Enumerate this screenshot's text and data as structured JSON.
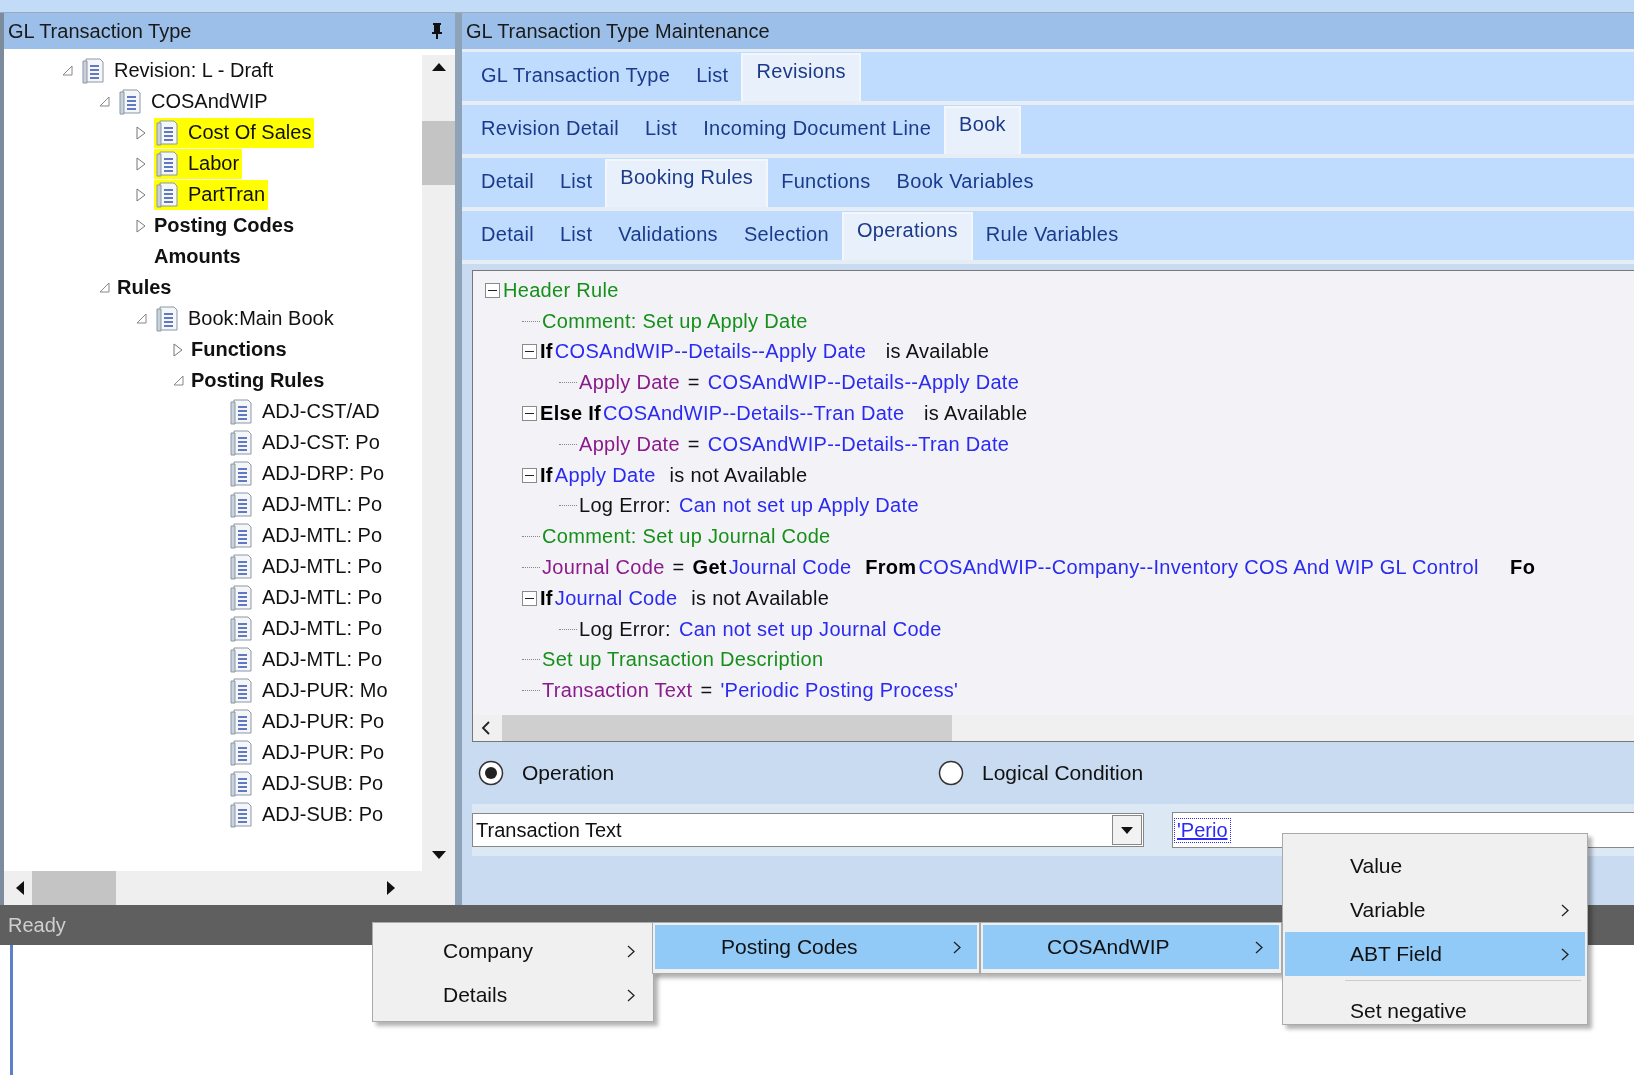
{
  "left_panel": {
    "title": "GL Transaction Type",
    "tree": [
      {
        "label": "Revision: L - Draft",
        "kind": "doc",
        "expanded": true,
        "highlighted": false,
        "children": [
          {
            "label": "COSAndWIP",
            "kind": "doc",
            "expanded": true,
            "highlighted": false,
            "children": [
              {
                "label": "Cost Of Sales",
                "kind": "doc",
                "expanded": false,
                "highlighted": true
              },
              {
                "label": "Labor",
                "kind": "doc",
                "expanded": false,
                "highlighted": true
              },
              {
                "label": "PartTran",
                "kind": "doc",
                "expanded": false,
                "highlighted": true
              },
              {
                "label": "Posting Codes",
                "kind": "group",
                "expanded": false,
                "highlighted": false
              },
              {
                "label": "Amounts",
                "kind": "group",
                "highlighted": false
              }
            ]
          },
          {
            "label": "Rules",
            "kind": "group",
            "expanded": true,
            "highlighted": false,
            "children": [
              {
                "label": "Book:Main Book",
                "kind": "doc",
                "expanded": true,
                "highlighted": false,
                "children": [
                  {
                    "label": "Functions",
                    "kind": "group",
                    "expanded": false,
                    "highlighted": false
                  },
                  {
                    "label": "Posting Rules",
                    "kind": "group",
                    "expanded": true,
                    "highlighted": false,
                    "children": [
                      {
                        "label": "ADJ-CST/AD",
                        "kind": "doc",
                        "highlighted": false
                      },
                      {
                        "label": "ADJ-CST: Po",
                        "kind": "doc",
                        "highlighted": false
                      },
                      {
                        "label": "ADJ-DRP: Po",
                        "kind": "doc",
                        "highlighted": false
                      },
                      {
                        "label": "ADJ-MTL: Po",
                        "kind": "doc",
                        "highlighted": false
                      },
                      {
                        "label": "ADJ-MTL: Po",
                        "kind": "doc",
                        "highlighted": false
                      },
                      {
                        "label": "ADJ-MTL: Po",
                        "kind": "doc",
                        "highlighted": false
                      },
                      {
                        "label": "ADJ-MTL: Po",
                        "kind": "doc",
                        "highlighted": false
                      },
                      {
                        "label": "ADJ-MTL: Po",
                        "kind": "doc",
                        "highlighted": false
                      },
                      {
                        "label": "ADJ-MTL: Po",
                        "kind": "doc",
                        "highlighted": false
                      },
                      {
                        "label": "ADJ-PUR: Mo",
                        "kind": "doc",
                        "highlighted": false
                      },
                      {
                        "label": "ADJ-PUR: Po",
                        "kind": "doc",
                        "highlighted": false
                      },
                      {
                        "label": "ADJ-PUR: Po",
                        "kind": "doc",
                        "highlighted": false
                      },
                      {
                        "label": "ADJ-SUB: Po",
                        "kind": "doc",
                        "highlighted": false
                      },
                      {
                        "label": "ADJ-SUB: Po",
                        "kind": "doc",
                        "highlighted": false
                      }
                    ]
                  }
                ]
              }
            ]
          }
        ]
      }
    ]
  },
  "right_panel": {
    "title": "GL Transaction Type Maintenance",
    "tab_rows": [
      {
        "tabs": [
          {
            "label": "GL Transaction Type",
            "selected": false
          },
          {
            "label": "List",
            "selected": false
          },
          {
            "label": "Revisions",
            "selected": true
          }
        ]
      },
      {
        "tabs": [
          {
            "label": "Revision Detail",
            "selected": false
          },
          {
            "label": "List",
            "selected": false
          },
          {
            "label": "Incoming Document Line",
            "selected": false
          },
          {
            "label": "Book",
            "selected": true
          }
        ]
      },
      {
        "tabs": [
          {
            "label": "Detail",
            "selected": false
          },
          {
            "label": "List",
            "selected": false
          },
          {
            "label": "Booking Rules",
            "selected": true
          },
          {
            "label": "Functions",
            "selected": false
          },
          {
            "label": "Book Variables",
            "selected": false
          }
        ]
      },
      {
        "tabs": [
          {
            "label": "Detail",
            "selected": false
          },
          {
            "label": "List",
            "selected": false
          },
          {
            "label": "Validations",
            "selected": false
          },
          {
            "label": "Selection",
            "selected": false
          },
          {
            "label": "Operations",
            "selected": true
          },
          {
            "label": "Rule Variables",
            "selected": false
          }
        ]
      }
    ],
    "rule_tree": [
      {
        "segments": [
          {
            "kind": "comment",
            "text": "Header Rule"
          }
        ],
        "expanded": true,
        "children": [
          {
            "segments": [
              {
                "kind": "comment",
                "text": "Comment: Set up Apply Date"
              }
            ]
          },
          {
            "segments": [
              {
                "kind": "keyword",
                "text": "If"
              },
              {
                "kind": "field",
                "text": "COSAndWIP--Details--Apply Date"
              },
              {
                "kind": "text",
                "text": "  is Available"
              }
            ],
            "expanded": true,
            "children": [
              {
                "segments": [
                  {
                    "kind": "variable",
                    "text": "Apply Date"
                  },
                  {
                    "kind": "text",
                    "text": "="
                  },
                  {
                    "kind": "field",
                    "text": "COSAndWIP--Details--Apply Date"
                  }
                ]
              }
            ]
          },
          {
            "segments": [
              {
                "kind": "keyword",
                "text": "Else If"
              },
              {
                "kind": "field",
                "text": "COSAndWIP--Details--Tran Date"
              },
              {
                "kind": "text",
                "text": "  is Available"
              }
            ],
            "expanded": true,
            "children": [
              {
                "segments": [
                  {
                    "kind": "variable",
                    "text": "Apply Date"
                  },
                  {
                    "kind": "text",
                    "text": "="
                  },
                  {
                    "kind": "field",
                    "text": "COSAndWIP--Details--Tran Date"
                  }
                ]
              }
            ]
          },
          {
            "segments": [
              {
                "kind": "keyword",
                "text": "If"
              },
              {
                "kind": "field",
                "text": "Apply Date"
              },
              {
                "kind": "text",
                "text": " is not Available"
              }
            ],
            "expanded": true,
            "children": [
              {
                "segments": [
                  {
                    "kind": "text",
                    "text": "Log Error:"
                  },
                  {
                    "kind": "field",
                    "text": "Can not set up Apply Date"
                  }
                ]
              }
            ]
          },
          {
            "segments": [
              {
                "kind": "comment",
                "text": "Comment: Set up Journal Code"
              }
            ]
          },
          {
            "segments": [
              {
                "kind": "variable",
                "text": "Journal Code"
              },
              {
                "kind": "text",
                "text": "="
              },
              {
                "kind": "keyword",
                "text": "Get"
              },
              {
                "kind": "field",
                "text": "Journal Code"
              },
              {
                "kind": "keyword",
                "text": " From"
              },
              {
                "kind": "field",
                "text": "COSAndWIP--Company--Inventory COS And WIP GL Control"
              },
              {
                "kind": "keyword",
                "text": "    Fo"
              }
            ]
          },
          {
            "segments": [
              {
                "kind": "keyword",
                "text": "If"
              },
              {
                "kind": "field",
                "text": "Journal Code"
              },
              {
                "kind": "text",
                "text": " is not Available"
              }
            ],
            "expanded": true,
            "children": [
              {
                "segments": [
                  {
                    "kind": "text",
                    "text": "Log Error:"
                  },
                  {
                    "kind": "field",
                    "text": "Can not set up Journal Code"
                  }
                ]
              }
            ]
          },
          {
            "segments": [
              {
                "kind": "comment",
                "text": "Set up Transaction Description"
              }
            ]
          },
          {
            "segments": [
              {
                "kind": "variable",
                "text": "Transaction Text"
              },
              {
                "kind": "text",
                "text": "="
              },
              {
                "kind": "field",
                "text": "'Periodic Posting Process'"
              }
            ]
          }
        ]
      }
    ],
    "radios": [
      {
        "label": "Operation",
        "selected": true
      },
      {
        "label": "Logical Condition",
        "selected": false
      }
    ],
    "target_dropdown": {
      "value": "Transaction Text"
    },
    "value_link": "'Perio"
  },
  "status_bar": {
    "text": "Ready"
  },
  "menus": [
    {
      "items": [
        {
          "label": "Company",
          "submenu": true,
          "selected": false
        },
        {
          "label": "Details",
          "submenu": true,
          "selected": false
        }
      ]
    },
    {
      "items": [
        {
          "label": "Posting Codes",
          "submenu": true,
          "selected": true
        }
      ]
    },
    {
      "items": [
        {
          "label": "COSAndWIP",
          "submenu": true,
          "selected": true
        }
      ]
    },
    {
      "items": [
        {
          "kind": "item",
          "label": "Value",
          "submenu": false,
          "selected": false
        },
        {
          "kind": "item",
          "label": "Variable",
          "submenu": true,
          "selected": false
        },
        {
          "kind": "item",
          "label": "ABT Field",
          "submenu": true,
          "selected": true
        },
        {
          "kind": "separator"
        },
        {
          "kind": "item",
          "label": "Set negative",
          "submenu": false,
          "selected": false
        }
      ]
    }
  ]
}
